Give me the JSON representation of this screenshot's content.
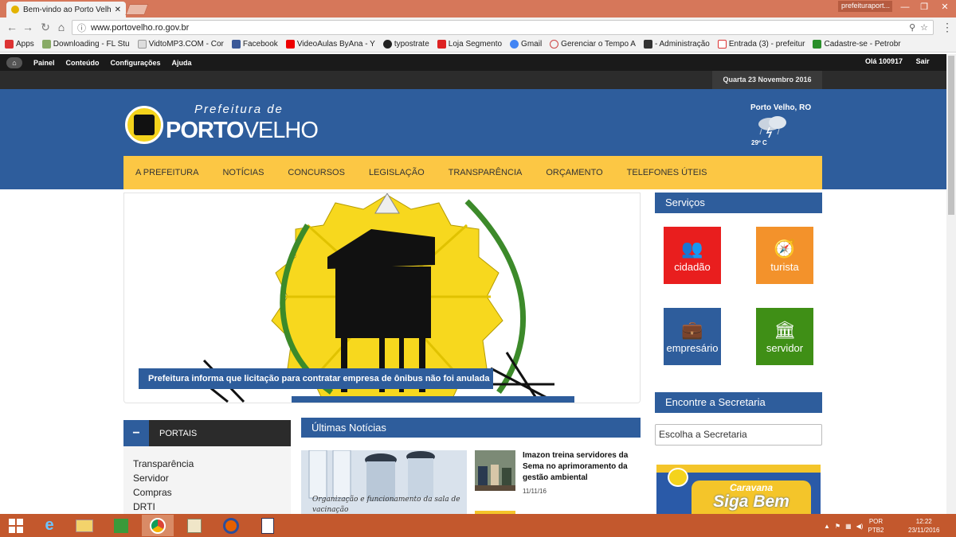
{
  "browser": {
    "tab_title": "Bem-vindo ao Porto Velho",
    "title_user": "prefeituraport...",
    "url": "www.portovelho.ro.gov.br",
    "bookmarks": [
      "Apps",
      "Downloading - FL Stu",
      "VidtoMP3.COM - Cor",
      "Facebook",
      "VideoAulas ByAna - Y",
      "typostrate",
      "Loja Segmento",
      "Gmail",
      "Gerenciar o Tempo A",
      "- Administração",
      "Entrada (3) - prefeitur",
      "Cadastre-se - Petrobr"
    ]
  },
  "adminbar": {
    "items": [
      "Painel",
      "Conteúdo",
      "Configurações",
      "Ajuda"
    ],
    "greeting": "Olá",
    "user": "100917",
    "logout": "Sair",
    "date": "Quarta 23 Novembro 2016"
  },
  "header": {
    "brand_top": "Prefeitura de",
    "brand_bold": "PORTO",
    "brand_light": "VELHO",
    "weather_city": "Porto Velho, RO",
    "weather_temp": "29º C"
  },
  "nav": [
    "A PREFEITURA",
    "NOTÍCIAS",
    "CONCURSOS",
    "LEGISLAÇÃO",
    "TRANSPARÊNCIA",
    "ORÇAMENTO",
    "TELEFONES ÚTEIS"
  ],
  "slider": {
    "caption": "Prefeitura informa que licitação para contratar empresa de ônibus não foi anulada"
  },
  "services": {
    "title": "Serviços",
    "tiles": [
      {
        "label": "cidadão",
        "color": "#e91e1e",
        "icon": "users-icon"
      },
      {
        "label": "turista",
        "color": "#f3922b",
        "icon": "compass-icon"
      },
      {
        "label": "empresário",
        "color": "#2e5d9c",
        "icon": "briefcase-icon"
      },
      {
        "label": "servidor",
        "color": "#3f8f16",
        "icon": "bank-icon"
      }
    ]
  },
  "secretaria": {
    "title": "Encontre a Secretaria",
    "select": "Escolha a Secretaria"
  },
  "banner": {
    "line1": "Caravana",
    "line2": "Siga Bem"
  },
  "portais": {
    "title": "PORTAIS",
    "toggle": "−",
    "links": [
      "Transparência",
      "Servidor",
      "Compras",
      "DRTI"
    ]
  },
  "news": {
    "title": "Últimas Notícias",
    "img_caption": "Organização e funcionamento da sala de vacinação",
    "item_title": "Imazon treina servidores da Sema no aprimoramento da gestão ambiental",
    "item_date": "11/11/16"
  },
  "taskbar": {
    "lang1": "POR",
    "lang2": "PTB2",
    "time": "12:22",
    "date": "23/11/2016"
  }
}
